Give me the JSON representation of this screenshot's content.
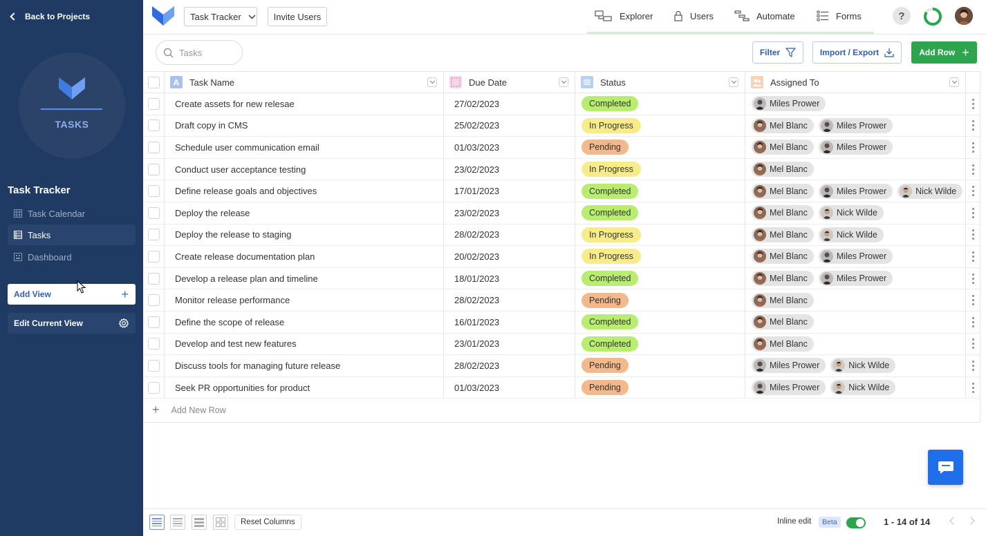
{
  "sidebar": {
    "back_label": "Back to Projects",
    "logo_label": "TASKS",
    "project_title": "Task Tracker",
    "nav": [
      {
        "label": "Task Calendar",
        "icon": "calendar-grid-icon",
        "active": false
      },
      {
        "label": "Tasks",
        "icon": "table-icon",
        "active": true
      },
      {
        "label": "Dashboard",
        "icon": "dashboard-icon",
        "active": false
      }
    ],
    "add_view_label": "Add View",
    "edit_view_label": "Edit Current View"
  },
  "header": {
    "tracker_select": "Task Tracker",
    "invite_label": "Invite Users",
    "tabs": [
      {
        "label": "Explorer",
        "icon": "explorer-icon"
      },
      {
        "label": "Users",
        "icon": "lock-icon"
      },
      {
        "label": "Automate",
        "icon": "automate-icon"
      },
      {
        "label": "Forms",
        "icon": "forms-icon"
      }
    ],
    "help_label": "?"
  },
  "toolbar": {
    "search_placeholder": "Tasks",
    "filter_label": "Filter",
    "import_label": "Import / Export",
    "add_row_label": "Add Row"
  },
  "grid": {
    "columns": [
      {
        "label": "Task Name",
        "icon": "text-field-icon"
      },
      {
        "label": "Due Date",
        "icon": "date-field-icon"
      },
      {
        "label": "Status",
        "icon": "list-field-icon"
      },
      {
        "label": "Assigned To",
        "icon": "user-field-icon"
      }
    ],
    "rows": [
      {
        "name": "Create assets for new relesae",
        "date": "27/02/2023",
        "status": "Completed",
        "assigned": [
          "Miles Prower"
        ]
      },
      {
        "name": "Draft copy in CMS",
        "date": "25/02/2023",
        "status": "In Progress",
        "assigned": [
          "Mel Blanc",
          "Miles Prower"
        ]
      },
      {
        "name": "Schedule user communication email",
        "date": "01/03/2023",
        "status": "Pending",
        "assigned": [
          "Mel Blanc",
          "Miles Prower"
        ]
      },
      {
        "name": "Conduct user acceptance testing",
        "date": "23/02/2023",
        "status": "In Progress",
        "assigned": [
          "Mel Blanc"
        ]
      },
      {
        "name": "Define release goals and objectives",
        "date": "17/01/2023",
        "status": "Completed",
        "assigned": [
          "Mel Blanc",
          "Miles Prower",
          "Nick Wilde"
        ]
      },
      {
        "name": "Deploy the release",
        "date": "23/02/2023",
        "status": "Completed",
        "assigned": [
          "Mel Blanc",
          "Nick Wilde"
        ]
      },
      {
        "name": "Deploy the release to staging",
        "date": "28/02/2023",
        "status": "In Progress",
        "assigned": [
          "Mel Blanc",
          "Nick Wilde"
        ]
      },
      {
        "name": "Create release documentation plan",
        "date": "20/02/2023",
        "status": "In Progress",
        "assigned": [
          "Mel Blanc",
          "Miles Prower"
        ]
      },
      {
        "name": "Develop a release plan and timeline",
        "date": "18/01/2023",
        "status": "Completed",
        "assigned": [
          "Mel Blanc",
          "Miles Prower"
        ]
      },
      {
        "name": "Monitor release performance",
        "date": "28/02/2023",
        "status": "Pending",
        "assigned": [
          "Mel Blanc"
        ]
      },
      {
        "name": "Define the scope of release",
        "date": "16/01/2023",
        "status": "Completed",
        "assigned": [
          "Mel Blanc"
        ]
      },
      {
        "name": "Develop and test new features",
        "date": "23/01/2023",
        "status": "Completed",
        "assigned": [
          "Mel Blanc"
        ]
      },
      {
        "name": "Discuss tools for managing future release",
        "date": "28/02/2023",
        "status": "Pending",
        "assigned": [
          "Miles Prower",
          "Nick Wilde"
        ]
      },
      {
        "name": "Seek PR opportunities for product",
        "date": "01/03/2023",
        "status": "Pending",
        "assigned": [
          "Miles Prower",
          "Nick Wilde"
        ]
      }
    ],
    "add_new_row_label": "Add New Row"
  },
  "status_colors": {
    "Completed": "#b8ed6f",
    "In Progress": "#f8ec8a",
    "Pending": "#f3b88c"
  },
  "colors": {
    "sidebar_bg": "#1f3a63",
    "accent_blue": "#2f5fb3",
    "accent_green": "#2ea44f"
  },
  "footer": {
    "reset_columns_label": "Reset Columns",
    "inline_edit_label": "Inline edit",
    "beta_label": "Beta",
    "inline_edit_on": true,
    "page_info": "1 - 14 of 14"
  }
}
